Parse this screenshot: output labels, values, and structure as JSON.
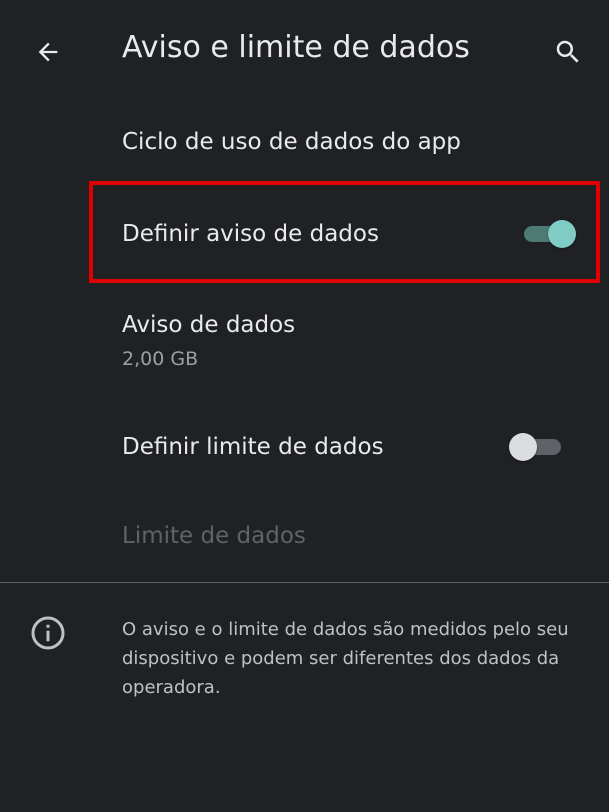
{
  "header": {
    "title": "Aviso e limite de dados",
    "back_icon": "arrow-back-icon",
    "search_icon": "search-icon"
  },
  "settings": {
    "app_data_cycle": {
      "label": "Ciclo de uso de dados do app"
    },
    "set_data_warning": {
      "label": "Definir aviso de dados",
      "enabled": true
    },
    "data_warning": {
      "label": "Aviso de dados",
      "value": "2,00 GB"
    },
    "set_data_limit": {
      "label": "Definir limite de dados",
      "enabled": false
    },
    "data_limit": {
      "label": "Limite de dados",
      "disabled": true
    }
  },
  "footer": {
    "icon": "info-icon",
    "text": "O aviso e o limite de dados são medidos pelo seu dispositivo e podem ser diferentes dos dados da operadora."
  },
  "colors": {
    "background": "#202124",
    "accent": "#80cbc4",
    "highlight": "#e00000"
  }
}
